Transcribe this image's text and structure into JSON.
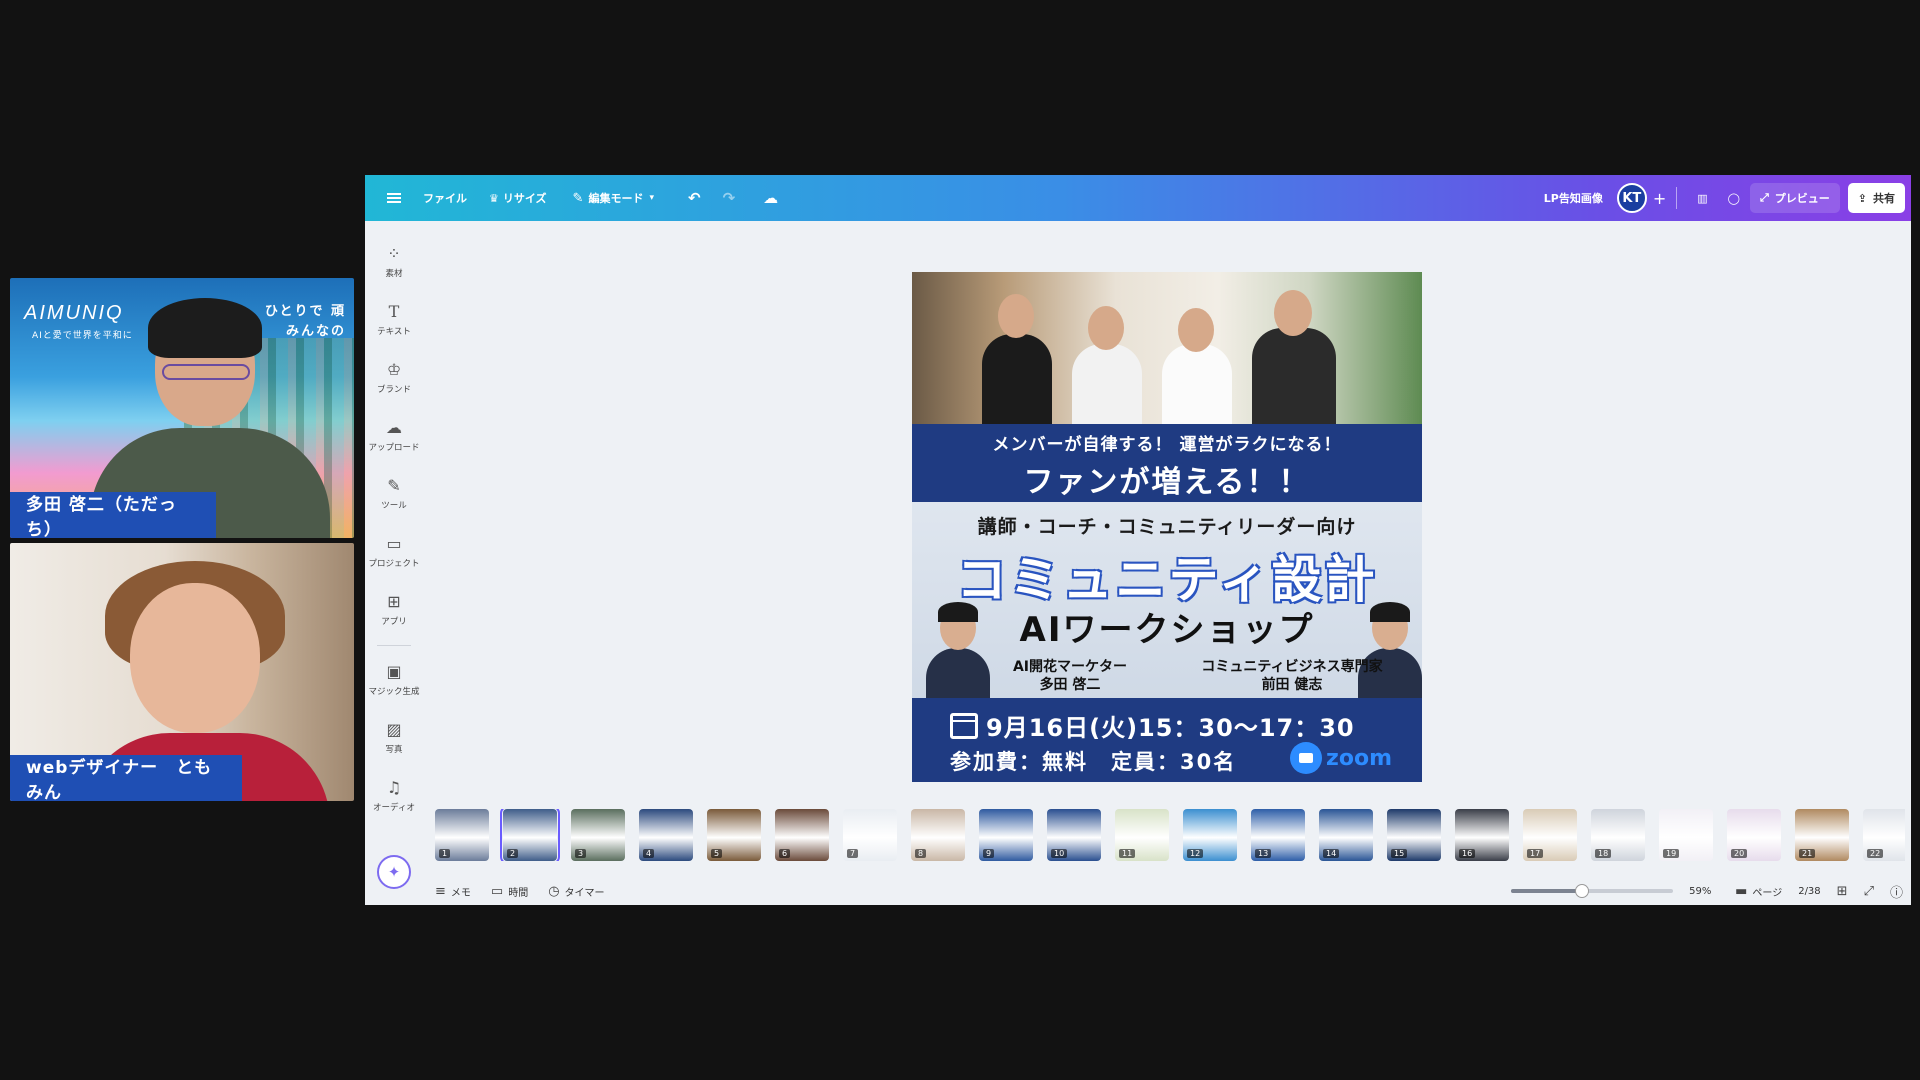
{
  "participants": [
    {
      "name": "多田 啓二（ただっち）",
      "background_brand": "AIMUNIQ",
      "background_tagline": "AIと愛で世界を平和に",
      "background_corner_text": [
        "ひとりで 頑",
        "みんなの"
      ]
    },
    {
      "name": "webデザイナー　ともみん"
    }
  ],
  "toolbar": {
    "menu_icon": "hamburger-icon",
    "file_label": "ファイル",
    "resize_label": "リサイズ",
    "edit_mode_label": "編集モード",
    "doc_title": "LP告知画像",
    "avatar_initials": "KT",
    "preview_label": "プレビュー",
    "share_label": "共有"
  },
  "sidebar": {
    "items": [
      {
        "label": "素材",
        "icon": "elements-icon"
      },
      {
        "label": "テキスト",
        "icon": "text-icon"
      },
      {
        "label": "ブランド",
        "icon": "brand-icon"
      },
      {
        "label": "アップロード",
        "icon": "upload-icon"
      },
      {
        "label": "ツール",
        "icon": "draw-icon"
      },
      {
        "label": "プロジェクト",
        "icon": "folder-icon"
      },
      {
        "label": "アプリ",
        "icon": "apps-icon"
      },
      {
        "label": "マジック生成",
        "icon": "magic-media-icon"
      },
      {
        "label": "写真",
        "icon": "photo-icon"
      },
      {
        "label": "オーディオ",
        "icon": "audio-icon"
      }
    ]
  },
  "poster": {
    "line1": "メンバーが自律する！ 運営がラクになる！",
    "line2": "ファンが増える！！",
    "subtitle": "講師・コーチ・コミュニティリーダー向け",
    "title": "コミュニティ設計",
    "workshop": "AIワークショップ",
    "speaker_left_role": "AI開花マーケター",
    "speaker_left_name": "多田 啓二",
    "speaker_right_role": "コミュニティビジネス専門家",
    "speaker_right_name": "前田 健志",
    "date": "9月16日(火)15：30〜17：30",
    "fee": "参加費：無料　定員：30名",
    "zoom_label": "zoom"
  },
  "thumbnails": {
    "count": 22,
    "selected_index": 1,
    "colors": [
      "#6b7c9a",
      "#3f5d8a",
      "#5a6e5e",
      "#2c4a7e",
      "#7a5a3a",
      "#6a4a3a",
      "#e9edf2",
      "#c9b7a6",
      "#2f5aa0",
      "#2a4f90",
      "#d8e2c8",
      "#3b8fd0",
      "#2e5ea8",
      "#2a5596",
      "#1e3a6a",
      "#3a3e48",
      "#d9cbb6",
      "#cfd4dc",
      "#f2f0f6",
      "#e7dcec",
      "#b08a60",
      "#e0e4ea"
    ]
  },
  "bottombar": {
    "notes_label": "メモ",
    "time_label": "時間",
    "timer_label": "タイマー",
    "zoom_percent": "59%",
    "zoom_fraction": 0.44,
    "pages_label": "ページ",
    "page_indicator": "2/38"
  }
}
